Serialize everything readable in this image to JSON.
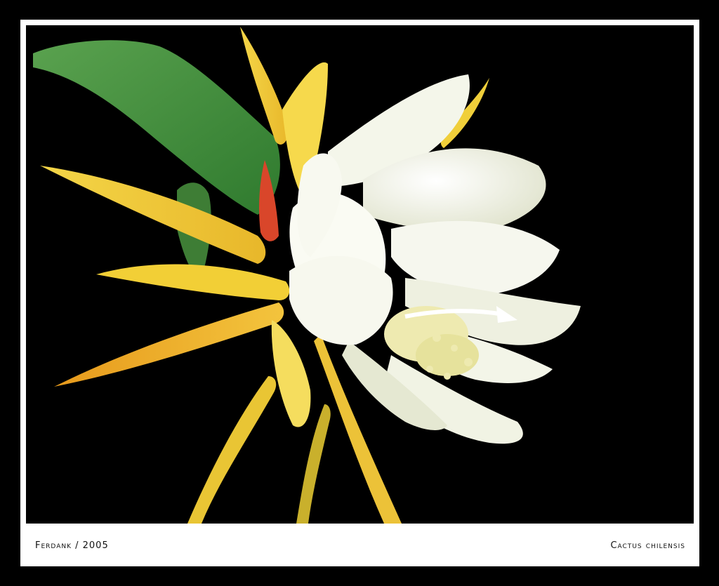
{
  "frame": {
    "colors": {
      "border": "#000000",
      "mat": "#ffffff",
      "background": "#000000"
    }
  },
  "photo": {
    "subject": "white and yellow cactus flower with green stem on black background",
    "colors": {
      "petal_white": "#f7f8ee",
      "petal_shadow": "#d9dcc6",
      "sepal_yellow": "#f2d23a",
      "sepal_orange": "#e59a1f",
      "bud_red": "#d9462a",
      "stem_green": "#3f8f3a",
      "stamen_cream": "#eeeab0"
    }
  },
  "caption": {
    "left": "Ferdank / 2005",
    "right": "Cactus chilensis"
  }
}
